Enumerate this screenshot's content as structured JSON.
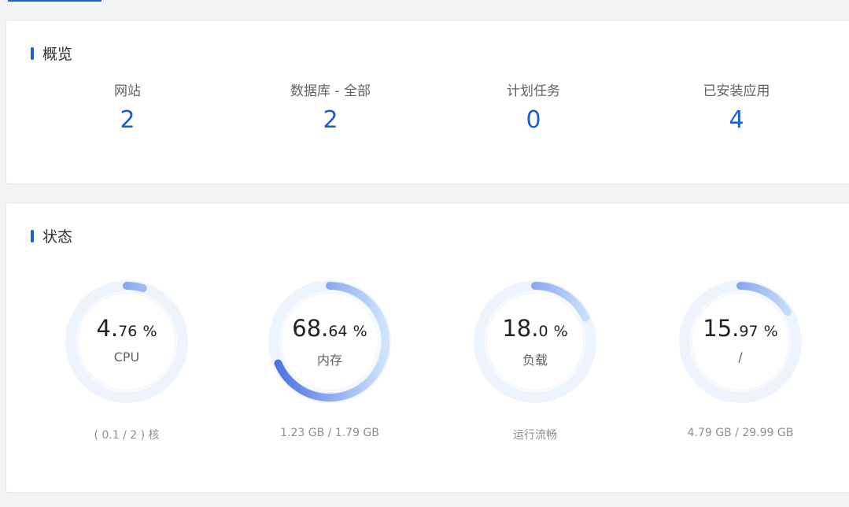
{
  "overview": {
    "title": "概览",
    "stats": [
      {
        "label": "网站",
        "value": "2"
      },
      {
        "label": "数据库 - 全部",
        "value": "2"
      },
      {
        "label": "计划任务",
        "value": "0"
      },
      {
        "label": "已安装应用",
        "value": "4"
      }
    ]
  },
  "status": {
    "title": "状态",
    "gauges": [
      {
        "int": "4.",
        "dec": "76",
        "pct": "%",
        "name": "CPU",
        "detail": "( 0.1 / 2 ) 核",
        "percent": 4.76
      },
      {
        "int": "68.",
        "dec": "64",
        "pct": "%",
        "name": "内存",
        "detail": "1.23 GB / 1.79 GB",
        "percent": 68.64
      },
      {
        "int": "18.",
        "dec": "0",
        "pct": "%",
        "name": "负载",
        "detail": "运行流畅",
        "percent": 18.0
      },
      {
        "int": "15.",
        "dec": "97",
        "pct": "%",
        "name": "/",
        "detail": "4.79 GB / 29.99 GB",
        "percent": 15.97
      }
    ]
  },
  "colors": {
    "accent": "#1a5fd1",
    "gauge_track": "#eef4fd",
    "gauge_start": "#4a6fe3",
    "gauge_end": "#cfe4fb"
  }
}
